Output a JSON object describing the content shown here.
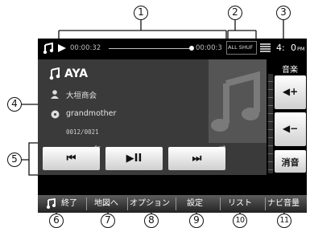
{
  "status_bar": {
    "elapsed": "00:00:32",
    "total": "00:00:3",
    "mode": "ALL SHUF",
    "clock_prefix": "4:",
    "clock_suffix": "0",
    "ampm": "PM"
  },
  "track": {
    "title": "AYA",
    "artist": "大垣商会",
    "album": "grandmother",
    "number": "0012/0021"
  },
  "controls": {
    "prev": "⏮",
    "play_pause": "▶II",
    "next": "⏭"
  },
  "side": {
    "label": "音楽",
    "vol_up": "◀+",
    "vol_down": "◀−",
    "mute": "消音"
  },
  "bottom_menu": [
    "終了",
    "地図へ",
    "オプション",
    "設定",
    "リスト",
    "ナビ音量"
  ],
  "callouts": [
    "1",
    "2",
    "3",
    "4",
    "5",
    "6",
    "7",
    "8",
    "9",
    "10",
    "11"
  ],
  "colors": {
    "screen": "#000000",
    "panel": "#3a3a3a",
    "callout_frame": "#111111"
  }
}
